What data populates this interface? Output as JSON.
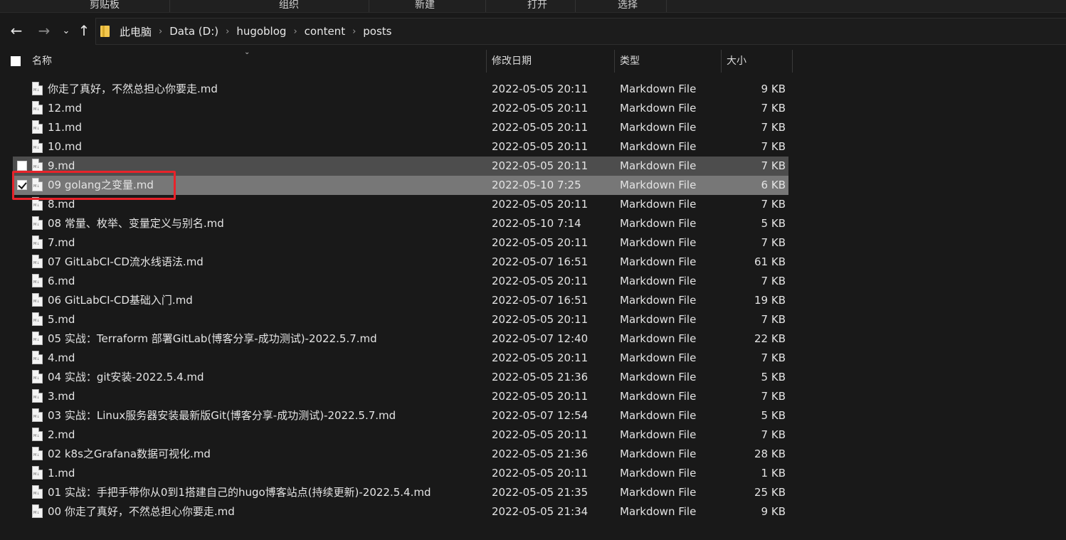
{
  "ribbon": {
    "groups": [
      "剪贴板",
      "组织",
      "新建",
      "打开",
      "选择"
    ]
  },
  "nav": {
    "breadcrumbs": [
      "此电脑",
      "Data (D:)",
      "hugoblog",
      "content",
      "posts"
    ]
  },
  "columns": {
    "name": "名称",
    "date": "修改日期",
    "type": "类型",
    "size": "大小"
  },
  "files": [
    {
      "name": "你走了真好，不然总担心你要走.md",
      "date": "2022-05-05 20:11",
      "type": "Markdown File",
      "size": "9 KB"
    },
    {
      "name": "12.md",
      "date": "2022-05-05 20:11",
      "type": "Markdown File",
      "size": "7 KB"
    },
    {
      "name": "11.md",
      "date": "2022-05-05 20:11",
      "type": "Markdown File",
      "size": "7 KB"
    },
    {
      "name": "10.md",
      "date": "2022-05-05 20:11",
      "type": "Markdown File",
      "size": "7 KB"
    },
    {
      "name": "9.md",
      "date": "2022-05-05 20:11",
      "type": "Markdown File",
      "size": "7 KB",
      "state": "hover"
    },
    {
      "name": "09 golang之变量.md",
      "date": "2022-05-10 7:25",
      "type": "Markdown File",
      "size": "6 KB",
      "state": "selected"
    },
    {
      "name": "8.md",
      "date": "2022-05-05 20:11",
      "type": "Markdown File",
      "size": "7 KB"
    },
    {
      "name": "08 常量、枚举、变量定义与别名.md",
      "date": "2022-05-10 7:14",
      "type": "Markdown File",
      "size": "5 KB"
    },
    {
      "name": "7.md",
      "date": "2022-05-05 20:11",
      "type": "Markdown File",
      "size": "7 KB"
    },
    {
      "name": "07 GitLabCI-CD流水线语法.md",
      "date": "2022-05-07 16:51",
      "type": "Markdown File",
      "size": "61 KB"
    },
    {
      "name": "6.md",
      "date": "2022-05-05 20:11",
      "type": "Markdown File",
      "size": "7 KB"
    },
    {
      "name": "06 GitLabCI-CD基础入门.md",
      "date": "2022-05-07 16:51",
      "type": "Markdown File",
      "size": "19 KB"
    },
    {
      "name": "5.md",
      "date": "2022-05-05 20:11",
      "type": "Markdown File",
      "size": "7 KB"
    },
    {
      "name": "05 实战：Terraform 部署GitLab(博客分享-成功测试)-2022.5.7.md",
      "date": "2022-05-07 12:40",
      "type": "Markdown File",
      "size": "22 KB"
    },
    {
      "name": "4.md",
      "date": "2022-05-05 20:11",
      "type": "Markdown File",
      "size": "7 KB"
    },
    {
      "name": "04 实战：git安装-2022.5.4.md",
      "date": "2022-05-05 21:36",
      "type": "Markdown File",
      "size": "5 KB"
    },
    {
      "name": "3.md",
      "date": "2022-05-05 20:11",
      "type": "Markdown File",
      "size": "7 KB"
    },
    {
      "name": "03 实战：Linux服务器安装最新版Git(博客分享-成功测试)-2022.5.7.md",
      "date": "2022-05-07 12:54",
      "type": "Markdown File",
      "size": "5 KB"
    },
    {
      "name": "2.md",
      "date": "2022-05-05 20:11",
      "type": "Markdown File",
      "size": "7 KB"
    },
    {
      "name": "02 k8s之Grafana数据可视化.md",
      "date": "2022-05-05 21:36",
      "type": "Markdown File",
      "size": "28 KB"
    },
    {
      "name": "1.md",
      "date": "2022-05-05 20:11",
      "type": "Markdown File",
      "size": "1 KB"
    },
    {
      "name": "01 实战：手把手带你从0到1搭建自己的hugo博客站点(持续更新)-2022.5.4.md",
      "date": "2022-05-05 21:35",
      "type": "Markdown File",
      "size": "25 KB"
    },
    {
      "name": "00 你走了真好，不然总担心你要走.md",
      "date": "2022-05-05 21:34",
      "type": "Markdown File",
      "size": "9 KB"
    }
  ]
}
